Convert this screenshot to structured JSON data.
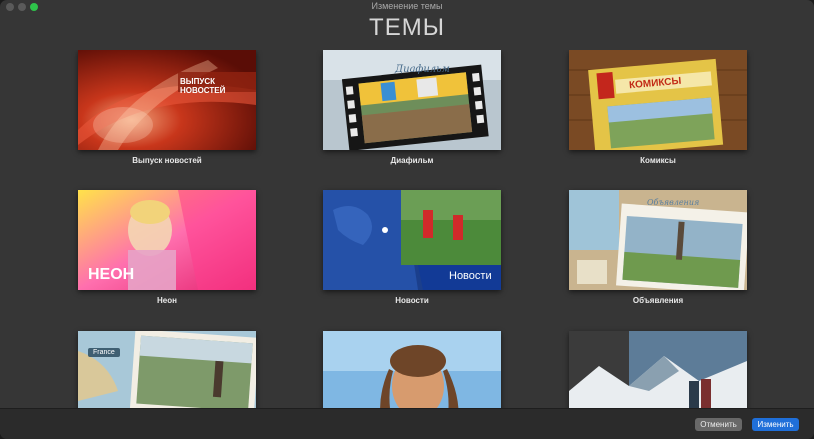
{
  "window": {
    "title": "Изменение темы"
  },
  "heading": "ТЕМЫ",
  "themes": [
    {
      "name": "Выпуск новостей",
      "overlay": "ВЫПУСК НОВОСТЕЙ"
    },
    {
      "name": "Диафильм",
      "overlay": "Диафильм"
    },
    {
      "name": "Комиксы",
      "overlay": "КОМИКСЫ"
    },
    {
      "name": "Неон",
      "overlay": "НЕОН"
    },
    {
      "name": "Новости",
      "overlay": "Новости"
    },
    {
      "name": "Объявления",
      "overlay": "Объявления"
    },
    {
      "name": "",
      "overlay": "France"
    },
    {
      "name": "",
      "overlay": ""
    },
    {
      "name": "",
      "overlay": ""
    }
  ],
  "buttons": {
    "cancel": "Отменить",
    "apply": "Изменить"
  }
}
